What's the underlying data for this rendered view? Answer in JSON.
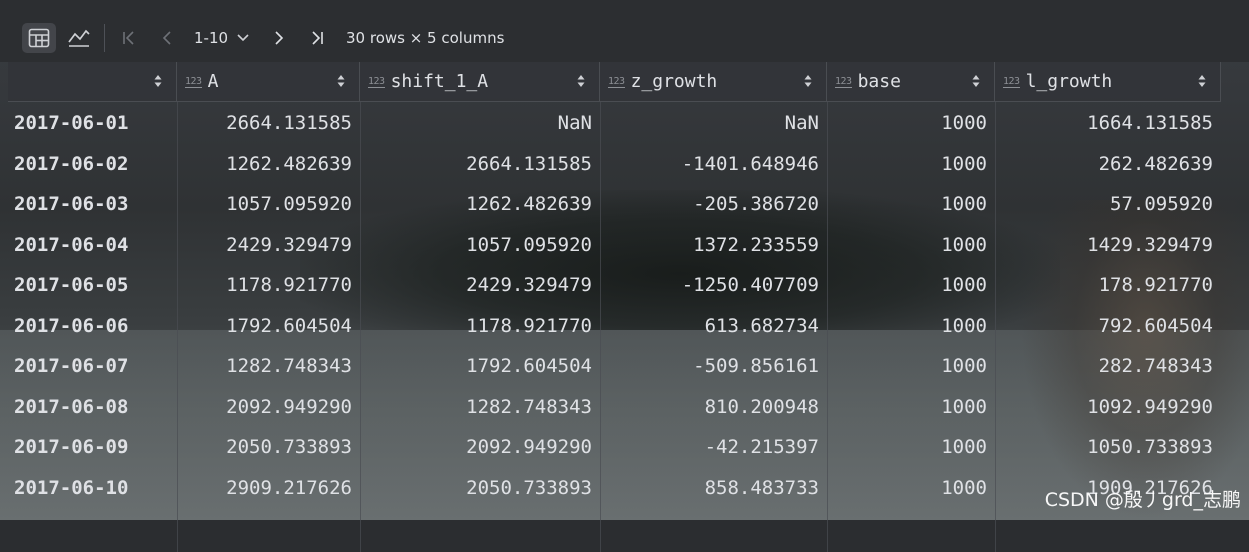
{
  "toolbar": {
    "table_view_icon": "table-grid-icon",
    "chart_view_icon": "line-chart-icon",
    "page_range": "1-10",
    "summary": "30 rows × 5 columns"
  },
  "columns": [
    {
      "key": "index",
      "label": "",
      "type_badge": ""
    },
    {
      "key": "A",
      "label": "A",
      "type_badge": "123"
    },
    {
      "key": "shift_1_A",
      "label": "shift_1_A",
      "type_badge": "123"
    },
    {
      "key": "z_growth",
      "label": "z_growth",
      "type_badge": "123"
    },
    {
      "key": "base",
      "label": "base",
      "type_badge": "123"
    },
    {
      "key": "l_growth",
      "label": "l_growth",
      "type_badge": "123"
    }
  ],
  "rows": [
    [
      "2017-06-01",
      "2664.131585",
      "NaN",
      "NaN",
      "1000",
      "1664.131585"
    ],
    [
      "2017-06-02",
      "1262.482639",
      "2664.131585",
      "-1401.648946",
      "1000",
      "262.482639"
    ],
    [
      "2017-06-03",
      "1057.095920",
      "1262.482639",
      "-205.386720",
      "1000",
      "57.095920"
    ],
    [
      "2017-06-04",
      "2429.329479",
      "1057.095920",
      "1372.233559",
      "1000",
      "1429.329479"
    ],
    [
      "2017-06-05",
      "1178.921770",
      "2429.329479",
      "-1250.407709",
      "1000",
      "178.921770"
    ],
    [
      "2017-06-06",
      "1792.604504",
      "1178.921770",
      "613.682734",
      "1000",
      "792.604504"
    ],
    [
      "2017-06-07",
      "1282.748343",
      "1792.604504",
      "-509.856161",
      "1000",
      "282.748343"
    ],
    [
      "2017-06-08",
      "2092.949290",
      "1282.748343",
      "810.200948",
      "1000",
      "1092.949290"
    ],
    [
      "2017-06-09",
      "2050.733893",
      "2092.949290",
      "-42.215397",
      "1000",
      "1050.733893"
    ],
    [
      "2017-06-10",
      "2909.217626",
      "2050.733893",
      "858.483733",
      "1000",
      "1909.217626"
    ]
  ],
  "watermark": "CSDN @殷丿grd_志鹏"
}
